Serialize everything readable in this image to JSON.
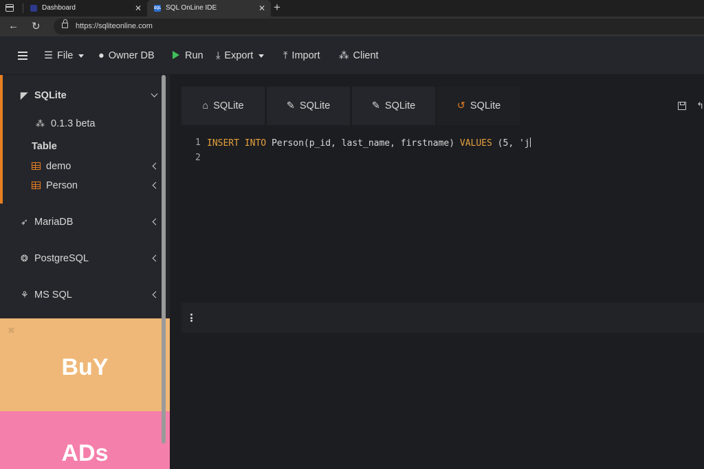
{
  "browser": {
    "tabs": [
      {
        "title": "Dashboard"
      },
      {
        "title": "SQL OnLine IDE",
        "favicon_text": "SQL"
      }
    ],
    "url": "https://sqliteonline.com"
  },
  "toolbar": {
    "file_label": "File",
    "owner_db_label": "Owner DB",
    "run_label": "Run",
    "export_label": "Export",
    "import_label": "Import",
    "client_label": "Client"
  },
  "sidebar": {
    "sqlite_label": "SQLite",
    "version_label": "0.1.3 beta",
    "table_header": "Table",
    "tables": [
      {
        "label": "demo"
      },
      {
        "label": "Person"
      }
    ],
    "databases": [
      {
        "label": "MariaDB"
      },
      {
        "label": "PostgreSQL"
      },
      {
        "label": "MS SQL"
      }
    ]
  },
  "ads": {
    "buy_text": "BuY",
    "ads_text": "ADs",
    "close_symbol": "✖"
  },
  "editor_tabs": [
    {
      "label": "SQLite",
      "icon": "home-icon"
    },
    {
      "label": "SQLite",
      "icon": "edit-icon"
    },
    {
      "label": "SQLite",
      "icon": "edit-icon"
    },
    {
      "label": "SQLite",
      "icon": "history-icon",
      "active": true
    }
  ],
  "editor": {
    "lines": [
      {
        "number": "1"
      },
      {
        "number": "2"
      }
    ],
    "code_line_1": {
      "kw1": "INSERT",
      "kw2": "INTO",
      "table_part": "Person(p_id, last_name, firstname)",
      "kw3": "VALUES",
      "open": "(",
      "value": "5",
      "sep": ", ",
      "partial": "'j"
    }
  },
  "colors": {
    "accent": "#e67e22",
    "run_green": "#3fbf5a",
    "keyword": "#e6a23c",
    "ad_buy": "#efb878",
    "ad_ads": "#f47faa"
  }
}
